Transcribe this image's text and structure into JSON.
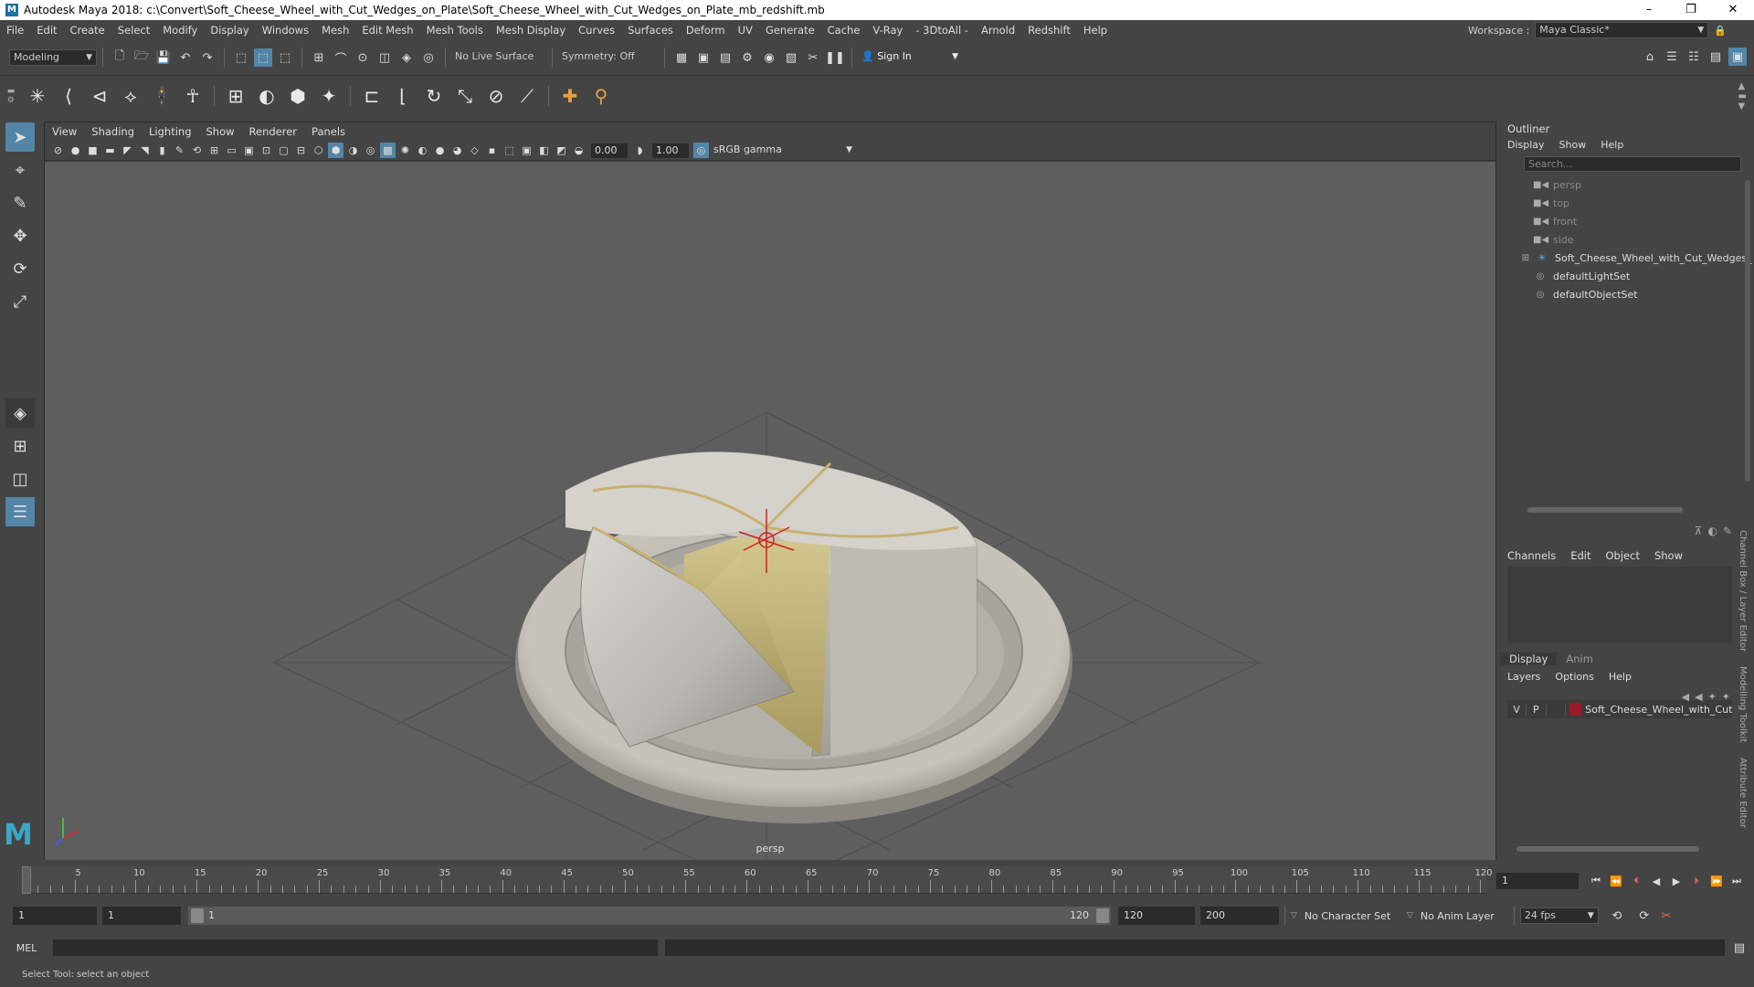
{
  "titlebar": {
    "title": "Autodesk Maya 2018: c:\\Convert\\Soft_Cheese_Wheel_with_Cut_Wedges_on_Plate\\Soft_Cheese_Wheel_with_Cut_Wedges_on_Plate_mb_redshift.mb"
  },
  "menubar": {
    "items": [
      "File",
      "Edit",
      "Create",
      "Select",
      "Modify",
      "Display",
      "Windows",
      "Mesh",
      "Edit Mesh",
      "Mesh Tools",
      "Mesh Display",
      "Curves",
      "Surfaces",
      "Deform",
      "UV",
      "Generate",
      "Cache",
      "V-Ray",
      "- 3DtoAll -",
      "Arnold",
      "Redshift",
      "Help"
    ],
    "workspace_label": "Workspace :",
    "workspace_value": "Maya Classic*"
  },
  "statusline": {
    "mode": "Modeling",
    "live_surface": "No Live Surface",
    "symmetry": "Symmetry: Off",
    "sign_in": "Sign In"
  },
  "viewport": {
    "menu": [
      "View",
      "Shading",
      "Lighting",
      "Show",
      "Renderer",
      "Panels"
    ],
    "exposure": "0.00",
    "gamma": "1.00",
    "color_space": "sRGB gamma",
    "camera_label": "persp"
  },
  "outliner": {
    "title": "Outliner",
    "menu": [
      "Display",
      "Show",
      "Help"
    ],
    "search_placeholder": "Search...",
    "items": [
      {
        "label": "persp",
        "dim": true
      },
      {
        "label": "top",
        "dim": true
      },
      {
        "label": "front",
        "dim": true
      },
      {
        "label": "side",
        "dim": true
      },
      {
        "label": "Soft_Cheese_Wheel_with_Cut_Wedges_",
        "dim": false
      },
      {
        "label": "defaultLightSet",
        "dim": false
      },
      {
        "label": "defaultObjectSet",
        "dim": false
      }
    ]
  },
  "channelbox": {
    "menu": [
      "Channels",
      "Edit",
      "Object",
      "Show"
    ]
  },
  "layereditor": {
    "tabs": [
      "Display",
      "Anim"
    ],
    "menu": [
      "Layers",
      "Options",
      "Help"
    ],
    "layer": {
      "v": "V",
      "p": "P",
      "name": "Soft_Cheese_Wheel_with_Cut_",
      "color": "#9b1a2a"
    }
  },
  "sidetabs": [
    "Channel Box / Layer Editor",
    "Modelling Toolkit",
    "Attribute Editor"
  ],
  "timeline": {
    "tick_labels": [
      "1",
      "5",
      "10",
      "15",
      "20",
      "25",
      "30",
      "35",
      "40",
      "45",
      "50",
      "55",
      "60",
      "65",
      "70",
      "75",
      "80",
      "85",
      "90",
      "95",
      "100",
      "105",
      "110",
      "115",
      "120"
    ],
    "current_frame": "1"
  },
  "range": {
    "start": "1",
    "playback_start": "1",
    "slider_start": "1",
    "slider_end": "120",
    "playback_end": "120",
    "end": "200",
    "character_set": "No Character Set",
    "anim_layer": "No Anim Layer",
    "fps": "24 fps"
  },
  "cmdline": {
    "label": "MEL"
  },
  "helpline": {
    "text": "Select Tool: select an object"
  }
}
